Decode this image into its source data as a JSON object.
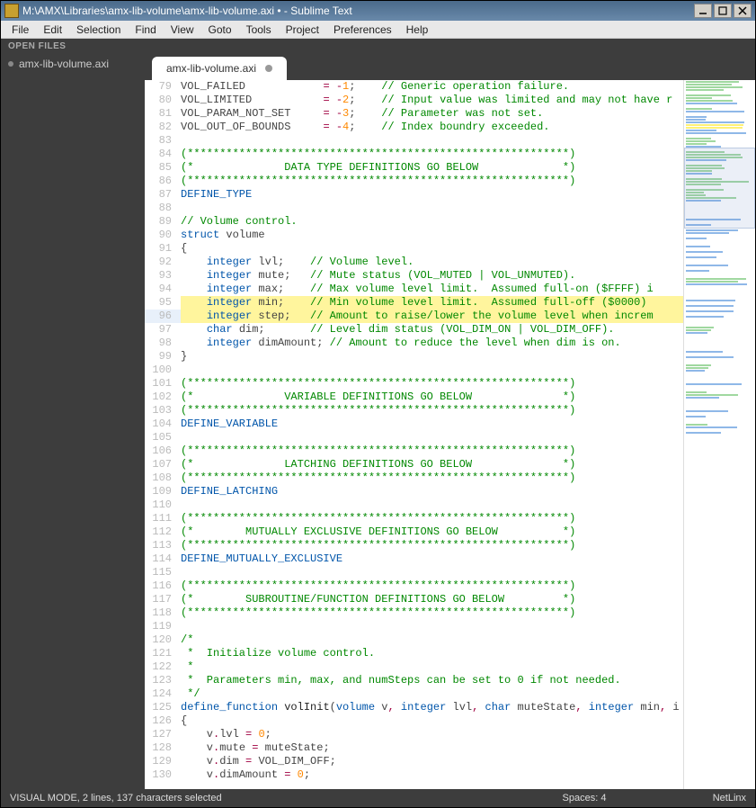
{
  "window": {
    "title": "M:\\AMX\\Libraries\\amx-lib-volume\\amx-lib-volume.axi • - Sublime Text"
  },
  "menu": {
    "items": [
      "File",
      "Edit",
      "Selection",
      "Find",
      "View",
      "Goto",
      "Tools",
      "Project",
      "Preferences",
      "Help"
    ]
  },
  "open_files_label": "OPEN FILES",
  "open_files": [
    {
      "name": "amx-lib-volume.axi"
    }
  ],
  "tab": {
    "label": "amx-lib-volume.axi"
  },
  "status": {
    "left": "VISUAL MODE, 2 lines, 137 characters selected",
    "spaces": "Spaces: 4",
    "syntax": "NetLinx"
  },
  "code": [
    {
      "n": 79,
      "seg": [
        [
          "ident",
          "VOL_FAILED            "
        ],
        [
          "op",
          "= "
        ],
        [
          "op",
          "-"
        ],
        [
          "num",
          "1"
        ],
        [
          "ident",
          ";    "
        ],
        [
          "com",
          "// Generic operation failure."
        ]
      ]
    },
    {
      "n": 80,
      "seg": [
        [
          "ident",
          "VOL_LIMITED           "
        ],
        [
          "op",
          "= "
        ],
        [
          "op",
          "-"
        ],
        [
          "num",
          "2"
        ],
        [
          "ident",
          ";    "
        ],
        [
          "com",
          "// Input value was limited and may not have r"
        ]
      ]
    },
    {
      "n": 81,
      "seg": [
        [
          "ident",
          "VOL_PARAM_NOT_SET     "
        ],
        [
          "op",
          "= "
        ],
        [
          "op",
          "-"
        ],
        [
          "num",
          "3"
        ],
        [
          "ident",
          ";    "
        ],
        [
          "com",
          "// Parameter was not set."
        ]
      ]
    },
    {
      "n": 82,
      "seg": [
        [
          "ident",
          "VOL_OUT_OF_BOUNDS     "
        ],
        [
          "op",
          "= "
        ],
        [
          "op",
          "-"
        ],
        [
          "num",
          "4"
        ],
        [
          "ident",
          ";    "
        ],
        [
          "com",
          "// Index boundry exceeded."
        ]
      ]
    },
    {
      "n": 83,
      "seg": []
    },
    {
      "n": 84,
      "seg": [
        [
          "com",
          "(***********************************************************)"
        ]
      ]
    },
    {
      "n": 85,
      "seg": [
        [
          "com",
          "(*              DATA TYPE DEFINITIONS GO BELOW             *)"
        ]
      ]
    },
    {
      "n": 86,
      "seg": [
        [
          "com",
          "(***********************************************************)"
        ]
      ]
    },
    {
      "n": 87,
      "seg": [
        [
          "kw",
          "DEFINE_TYPE"
        ]
      ]
    },
    {
      "n": 88,
      "seg": []
    },
    {
      "n": 89,
      "seg": [
        [
          "com",
          "// Volume control."
        ]
      ]
    },
    {
      "n": 90,
      "seg": [
        [
          "kw",
          "struct"
        ],
        [
          "ident",
          " "
        ],
        [
          "ident",
          "volume"
        ]
      ]
    },
    {
      "n": 91,
      "seg": [
        [
          "ident",
          "{"
        ]
      ]
    },
    {
      "n": 92,
      "seg": [
        [
          "ident",
          "    "
        ],
        [
          "type",
          "integer"
        ],
        [
          "ident",
          " lvl;    "
        ],
        [
          "com",
          "// Volume level."
        ]
      ]
    },
    {
      "n": 93,
      "seg": [
        [
          "ident",
          "    "
        ],
        [
          "type",
          "integer"
        ],
        [
          "ident",
          " mute;   "
        ],
        [
          "com",
          "// Mute status (VOL_MUTED | VOL_UNMUTED)."
        ]
      ]
    },
    {
      "n": 94,
      "seg": [
        [
          "ident",
          "    "
        ],
        [
          "type",
          "integer"
        ],
        [
          "ident",
          " max;    "
        ],
        [
          "com",
          "// Max volume level limit.  Assumed full-on ($FFFF) i"
        ]
      ]
    },
    {
      "n": 95,
      "sel": true,
      "seg": [
        [
          "ident",
          "    "
        ],
        [
          "type",
          "integer"
        ],
        [
          "ident",
          " min;    "
        ],
        [
          "com",
          "// Min volume level limit.  Assumed full-off ($0000) "
        ]
      ]
    },
    {
      "n": 96,
      "sel": true,
      "cur": true,
      "seg": [
        [
          "ident",
          "    "
        ],
        [
          "type",
          "integer"
        ],
        [
          "ident",
          " step;   "
        ],
        [
          "com",
          "// Amount to raise/lower the volume level when increm"
        ]
      ]
    },
    {
      "n": 97,
      "seg": [
        [
          "ident",
          "    "
        ],
        [
          "type",
          "char"
        ],
        [
          "ident",
          " dim;       "
        ],
        [
          "com",
          "// Level dim status (VOL_DIM_ON | VOL_DIM_OFF)."
        ]
      ]
    },
    {
      "n": 98,
      "seg": [
        [
          "ident",
          "    "
        ],
        [
          "type",
          "integer"
        ],
        [
          "ident",
          " dimAmount; "
        ],
        [
          "com",
          "// Amount to reduce the level when dim is on."
        ]
      ]
    },
    {
      "n": 99,
      "seg": [
        [
          "ident",
          "}"
        ]
      ]
    },
    {
      "n": 100,
      "seg": []
    },
    {
      "n": 101,
      "seg": [
        [
          "com",
          "(***********************************************************)"
        ]
      ]
    },
    {
      "n": 102,
      "seg": [
        [
          "com",
          "(*              VARIABLE DEFINITIONS GO BELOW              *)"
        ]
      ]
    },
    {
      "n": 103,
      "seg": [
        [
          "com",
          "(***********************************************************)"
        ]
      ]
    },
    {
      "n": 104,
      "seg": [
        [
          "kw",
          "DEFINE_VARIABLE"
        ]
      ]
    },
    {
      "n": 105,
      "seg": []
    },
    {
      "n": 106,
      "seg": [
        [
          "com",
          "(***********************************************************)"
        ]
      ]
    },
    {
      "n": 107,
      "seg": [
        [
          "com",
          "(*              LATCHING DEFINITIONS GO BELOW              *)"
        ]
      ]
    },
    {
      "n": 108,
      "seg": [
        [
          "com",
          "(***********************************************************)"
        ]
      ]
    },
    {
      "n": 109,
      "seg": [
        [
          "kw",
          "DEFINE_LATCHING"
        ]
      ]
    },
    {
      "n": 110,
      "seg": []
    },
    {
      "n": 111,
      "seg": [
        [
          "com",
          "(***********************************************************)"
        ]
      ]
    },
    {
      "n": 112,
      "seg": [
        [
          "com",
          "(*        MUTUALLY EXCLUSIVE DEFINITIONS GO BELOW          *)"
        ]
      ]
    },
    {
      "n": 113,
      "seg": [
        [
          "com",
          "(***********************************************************)"
        ]
      ]
    },
    {
      "n": 114,
      "seg": [
        [
          "kw",
          "DEFINE_MUTUALLY_EXCLUSIVE"
        ]
      ]
    },
    {
      "n": 115,
      "seg": []
    },
    {
      "n": 116,
      "seg": [
        [
          "com",
          "(***********************************************************)"
        ]
      ]
    },
    {
      "n": 117,
      "seg": [
        [
          "com",
          "(*        SUBROUTINE/FUNCTION DEFINITIONS GO BELOW         *)"
        ]
      ]
    },
    {
      "n": 118,
      "seg": [
        [
          "com",
          "(***********************************************************)"
        ]
      ]
    },
    {
      "n": 119,
      "seg": []
    },
    {
      "n": 120,
      "seg": [
        [
          "com",
          "/*"
        ]
      ]
    },
    {
      "n": 121,
      "seg": [
        [
          "com",
          " *  Initialize volume control."
        ]
      ]
    },
    {
      "n": 122,
      "seg": [
        [
          "com",
          " *"
        ]
      ]
    },
    {
      "n": 123,
      "seg": [
        [
          "com",
          " *  Parameters min, max, and numSteps can be set to 0 if not needed."
        ]
      ]
    },
    {
      "n": 124,
      "seg": [
        [
          "com",
          " */"
        ]
      ]
    },
    {
      "n": 125,
      "seg": [
        [
          "kw",
          "define_function"
        ],
        [
          "ident",
          " "
        ],
        [
          "fn",
          "volInit"
        ],
        [
          "ident",
          "("
        ],
        [
          "type",
          "volume"
        ],
        [
          "ident",
          " v"
        ],
        [
          "op",
          ","
        ],
        [
          "ident",
          " "
        ],
        [
          "type",
          "integer"
        ],
        [
          "ident",
          " lvl"
        ],
        [
          "op",
          ","
        ],
        [
          "ident",
          " "
        ],
        [
          "type",
          "char"
        ],
        [
          "ident",
          " muteState"
        ],
        [
          "op",
          ","
        ],
        [
          "ident",
          " "
        ],
        [
          "type",
          "integer"
        ],
        [
          "ident",
          " min"
        ],
        [
          "op",
          ","
        ],
        [
          "ident",
          " i"
        ]
      ]
    },
    {
      "n": 126,
      "seg": [
        [
          "ident",
          "{"
        ]
      ]
    },
    {
      "n": 127,
      "seg": [
        [
          "ident",
          "    v"
        ],
        [
          "op",
          "."
        ],
        [
          "ident",
          "lvl "
        ],
        [
          "op",
          "= "
        ],
        [
          "num",
          "0"
        ],
        [
          "ident",
          ";"
        ]
      ]
    },
    {
      "n": 128,
      "seg": [
        [
          "ident",
          "    v"
        ],
        [
          "op",
          "."
        ],
        [
          "ident",
          "mute "
        ],
        [
          "op",
          "= "
        ],
        [
          "ident",
          "muteState;"
        ]
      ]
    },
    {
      "n": 129,
      "seg": [
        [
          "ident",
          "    v"
        ],
        [
          "op",
          "."
        ],
        [
          "ident",
          "dim "
        ],
        [
          "op",
          "= "
        ],
        [
          "ident",
          "VOL_DIM_OFF;"
        ]
      ]
    },
    {
      "n": 130,
      "seg": [
        [
          "ident",
          "    v"
        ],
        [
          "op",
          "."
        ],
        [
          "ident",
          "dimAmount "
        ],
        [
          "op",
          "= "
        ],
        [
          "num",
          "0"
        ],
        [
          "ident",
          ";"
        ]
      ]
    }
  ]
}
